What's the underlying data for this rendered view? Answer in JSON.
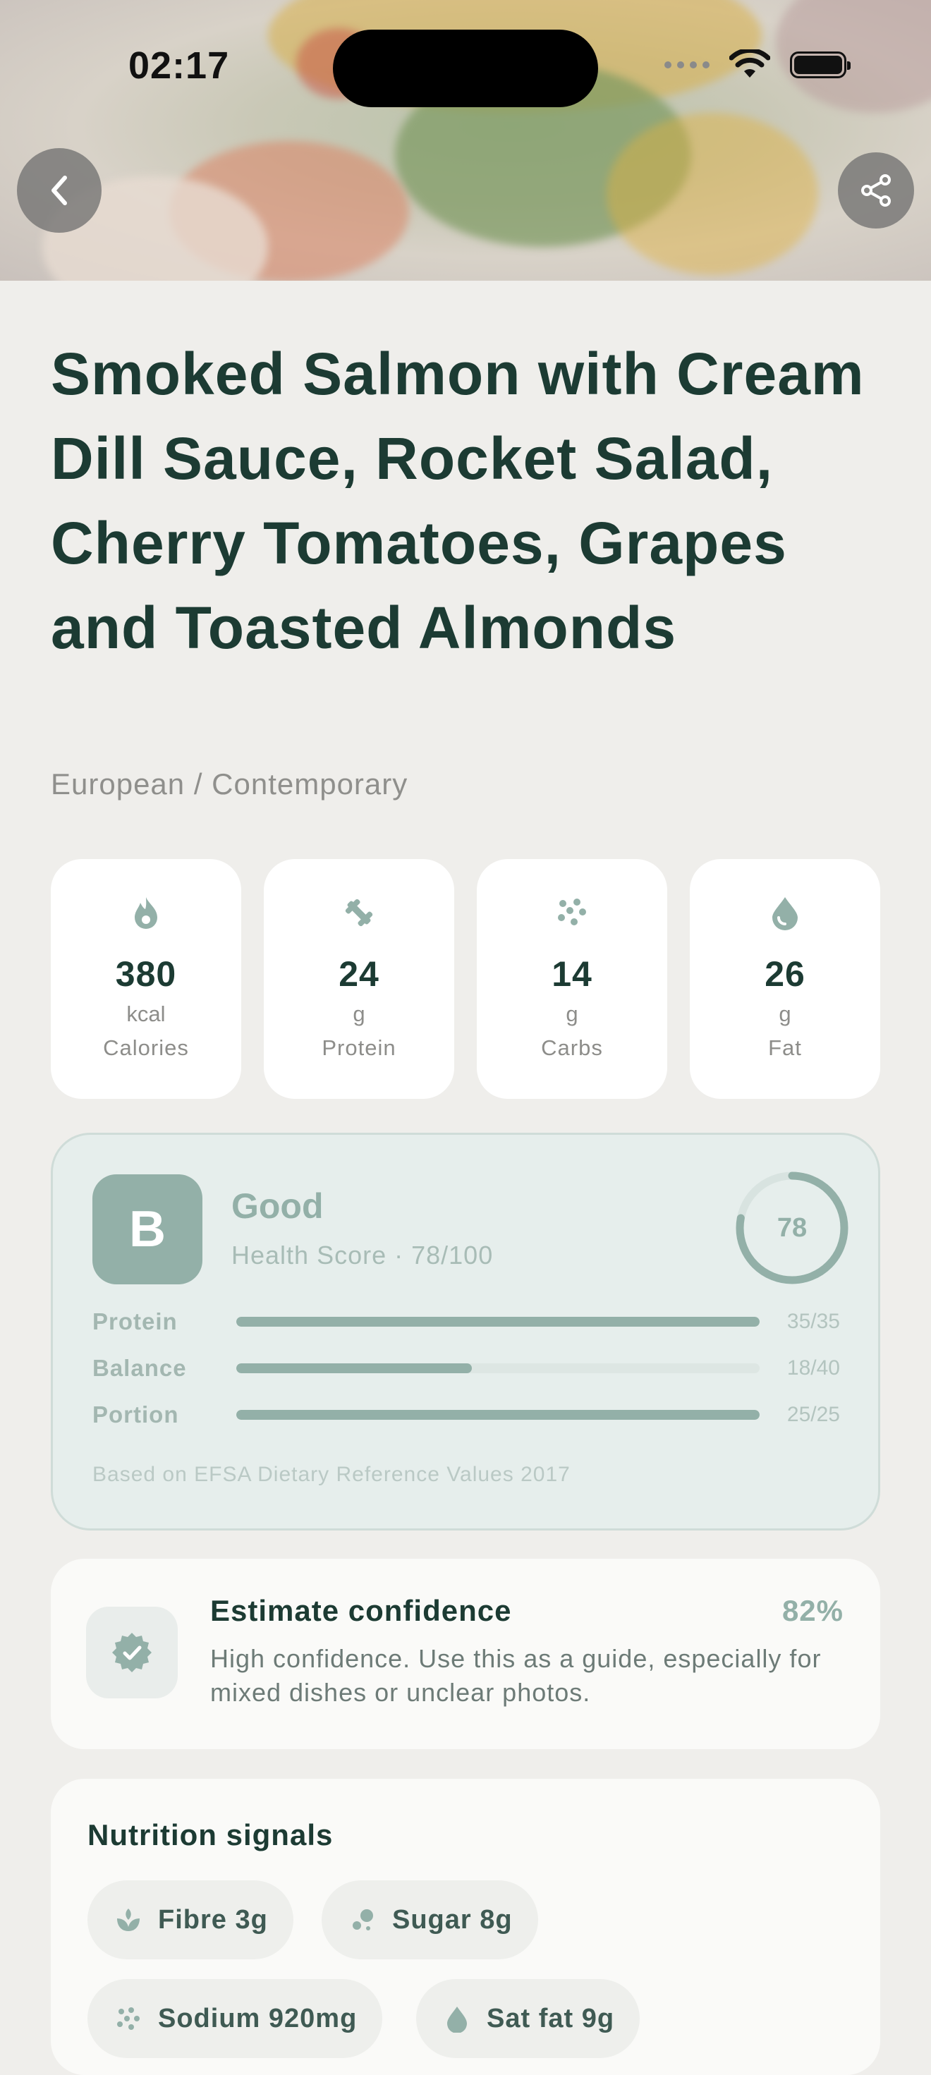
{
  "status_bar": {
    "time": "02:17"
  },
  "meal": {
    "title": "Smoked Salmon with Cream Dill Sauce, Rocket Salad, Cherry Tomatoes, Grapes and Toasted Almonds",
    "cuisine": "European / Contemporary"
  },
  "macros": [
    {
      "icon": "flame-icon",
      "value": "380",
      "unit": "kcal",
      "label": "Calories"
    },
    {
      "icon": "dumbbell-icon",
      "value": "24",
      "unit": "g",
      "label": "Protein"
    },
    {
      "icon": "grain-icon",
      "value": "14",
      "unit": "g",
      "label": "Carbs"
    },
    {
      "icon": "droplet-icon",
      "value": "26",
      "unit": "g",
      "label": "Fat"
    }
  ],
  "health_score": {
    "grade": "B",
    "label": "Good",
    "subtitle": "Health Score · 78/100",
    "score": "78",
    "score_value": 78,
    "score_max": 100,
    "bars": [
      {
        "label": "Protein",
        "value_text": "35/35",
        "fraction": 1.0
      },
      {
        "label": "Balance",
        "value_text": "18/40",
        "fraction": 0.45
      },
      {
        "label": "Portion",
        "value_text": "25/25",
        "fraction": 1.0
      }
    ],
    "source": "Based on EFSA Dietary Reference Values 2017",
    "accent_color": "#93b0a8"
  },
  "confidence": {
    "icon": "verified-badge-icon",
    "title": "Estimate confidence",
    "percent": "82%",
    "description": "High confidence. Use this as a guide, especially for mixed dishes or unclear photos."
  },
  "signals": {
    "title": "Nutrition signals",
    "items": [
      {
        "icon": "leaf-icon",
        "label": "Fibre 3g"
      },
      {
        "icon": "sugar-icon",
        "label": "Sugar 8g"
      },
      {
        "icon": "salt-icon",
        "label": "Sodium 920mg"
      },
      {
        "icon": "fat-drop-icon",
        "label": "Sat fat 9g"
      }
    ]
  },
  "colors": {
    "primary_text": "#1c3b33",
    "background": "#efeeeb",
    "card": "#ffffff"
  }
}
